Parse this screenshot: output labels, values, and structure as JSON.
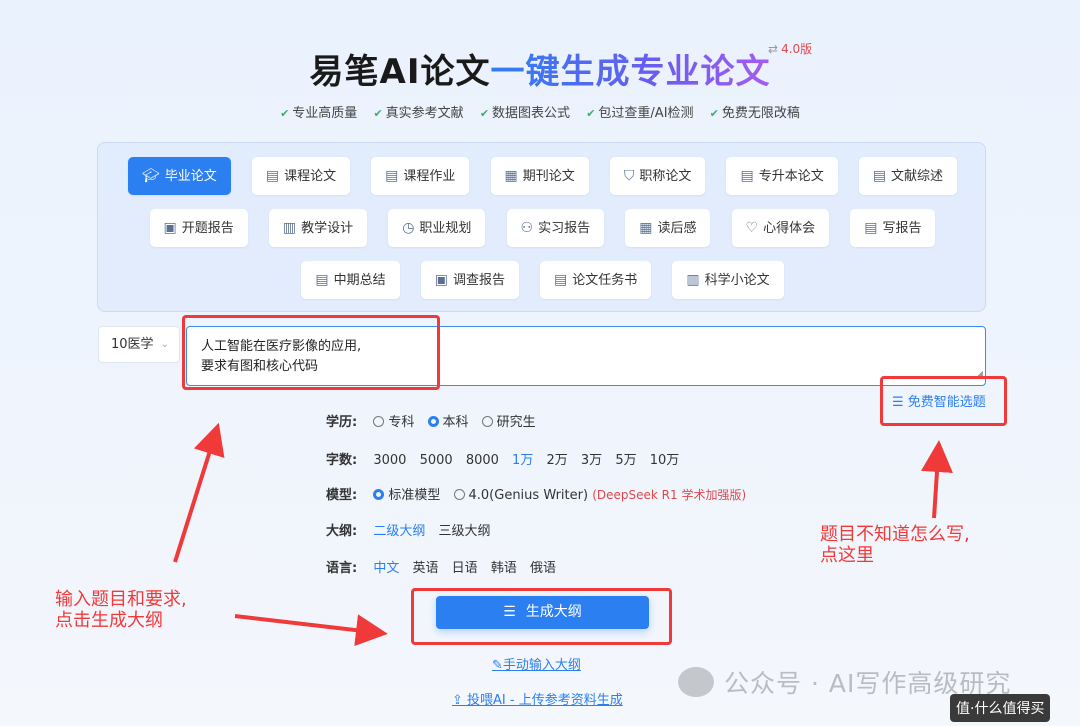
{
  "header": {
    "title_part1": "易笔AI论文",
    "title_part2": "一键生成专业论文",
    "version_label": "4.0版"
  },
  "features": [
    "专业高质量",
    "真实参考文献",
    "数据图表公式",
    "包过查重/AI检测",
    "免费无限改稿"
  ],
  "paper_types": {
    "row1": [
      {
        "label": "毕业论文",
        "icon": "graduation-cap-icon",
        "active": true
      },
      {
        "label": "课程论文",
        "icon": "document-icon"
      },
      {
        "label": "课程作业",
        "icon": "document-edit-icon"
      },
      {
        "label": "期刊论文",
        "icon": "journal-icon"
      },
      {
        "label": "职称论文",
        "icon": "shield-icon"
      },
      {
        "label": "专升本论文",
        "icon": "document-icon"
      },
      {
        "label": "文献综述",
        "icon": "document-icon"
      }
    ],
    "row2": [
      {
        "label": "开题报告",
        "icon": "report-icon"
      },
      {
        "label": "教学设计",
        "icon": "book-icon"
      },
      {
        "label": "职业规划",
        "icon": "clock-icon"
      },
      {
        "label": "实习报告",
        "icon": "user-icon"
      },
      {
        "label": "读后感",
        "icon": "calendar-icon"
      },
      {
        "label": "心得体会",
        "icon": "heart-icon"
      },
      {
        "label": "写报告",
        "icon": "document-edit-icon"
      }
    ],
    "row3": [
      {
        "label": "中期总结",
        "icon": "clipboard-icon"
      },
      {
        "label": "调查报告",
        "icon": "report-icon"
      },
      {
        "label": "论文任务书",
        "icon": "clipboard-icon"
      },
      {
        "label": "科学小论文",
        "icon": "book-icon"
      }
    ]
  },
  "subject_select": {
    "value": "10医学"
  },
  "topic_input": {
    "line1": "人工智能在医疗影像的应用,",
    "line2": "要求有图和核心代码"
  },
  "free_topic_link": "免费智能选题",
  "options": {
    "education": {
      "label": "学历:",
      "choices": [
        "专科",
        "本科",
        "研究生"
      ],
      "selected": "本科"
    },
    "words": {
      "label": "字数:",
      "choices": [
        "3000",
        "5000",
        "8000",
        "1万",
        "2万",
        "3万",
        "5万",
        "10万"
      ],
      "selected": "1万"
    },
    "model": {
      "label": "模型:",
      "choice1": "标准模型",
      "choice2": "4.0(Genius Writer)",
      "choice2_hint": "(DeepSeek R1 学术加强版)",
      "selected": "标准模型"
    },
    "outline": {
      "label": "大纲:",
      "choices": [
        "二级大纲",
        "三级大纲"
      ],
      "selected": "二级大纲"
    },
    "language": {
      "label": "语言:",
      "choices": [
        "中文",
        "英语",
        "日语",
        "韩语",
        "俄语"
      ],
      "selected": "中文"
    }
  },
  "buttons": {
    "generate": "生成大纲",
    "manual": "手动输入大纲",
    "upload": "投喂AI - 上传参考资料生成"
  },
  "annotations": {
    "left_line1": "输入题目和要求,",
    "left_line2": "点击生成大纲",
    "right_line1": "题目不知道怎么写,",
    "right_line2": "点这里"
  },
  "watermark": {
    "text": "公众号 · AI写作高级研究",
    "corner": "值·什么值得买"
  },
  "colors": {
    "accent": "#2b7ff0",
    "annotation_red": "#f03a3a",
    "hint_red": "#e0484e",
    "check_green": "#38b26a"
  }
}
